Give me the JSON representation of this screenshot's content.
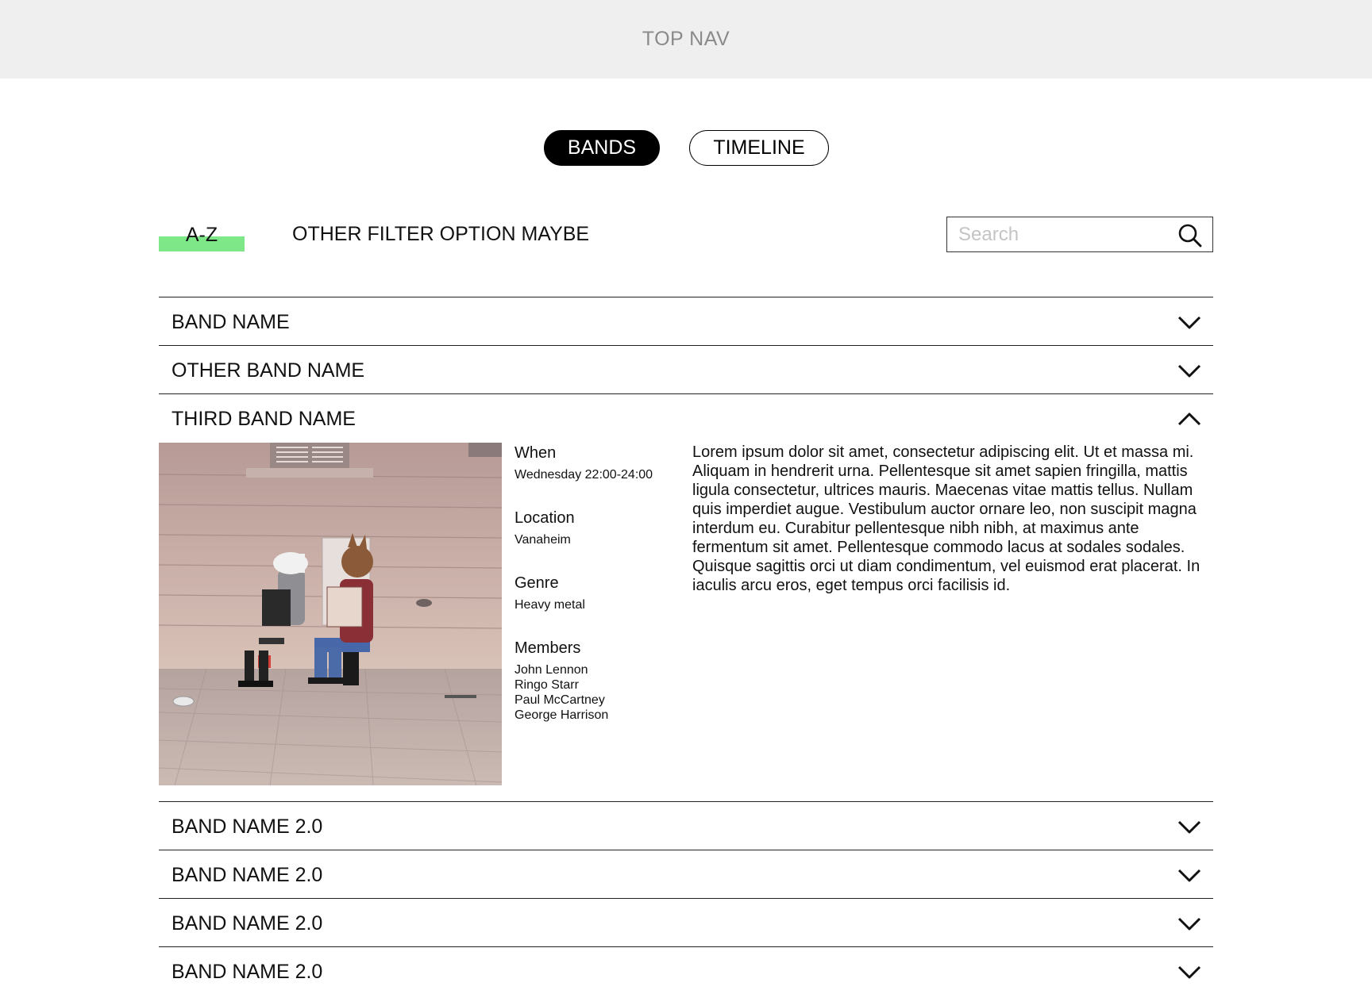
{
  "top_nav": {
    "label": "TOP NAV"
  },
  "view_toggle": {
    "bands": "BANDS",
    "timeline": "TIMELINE"
  },
  "filters": {
    "az": "A-Z",
    "other": "OTHER FILTER OPTION MAYBE"
  },
  "search": {
    "placeholder": "Search",
    "value": ""
  },
  "colors": {
    "filter_highlight": "#7ee787",
    "nav_bg": "#efefef"
  },
  "bands": [
    {
      "name": "BAND NAME",
      "expanded": false
    },
    {
      "name": "OTHER BAND NAME",
      "expanded": false
    },
    {
      "name": "THIRD BAND NAME",
      "expanded": true,
      "photo": "street-musicians-horse-masks-accordions",
      "when_label": "When",
      "when": "Wednesday 22:00-24:00",
      "location_label": "Location",
      "location": "Vanaheim",
      "genre_label": "Genre",
      "genre": "Heavy metal",
      "members_label": "Members",
      "members": [
        "John Lennon",
        "Ringo Starr",
        "Paul McCartney",
        "George Harrison"
      ],
      "description": "Lorem ipsum dolor sit amet, consectetur adipiscing elit. Ut et massa mi. Aliquam in hendrerit urna. Pellentesque sit amet sapien fringilla, mattis ligula consectetur, ultrices mauris. Maecenas vitae mattis tellus. Nullam quis imperdiet augue. Vestibulum auctor ornare leo, non suscipit magna interdum eu. Curabitur pellentesque nibh nibh, at maximus ante fermentum sit amet. Pellentesque commodo lacus at sodales sodales. Quisque sagittis orci ut diam condimentum, vel euismod erat placerat. In iaculis arcu eros, eget tempus orci facilisis id."
    },
    {
      "name": "BAND NAME 2.0",
      "expanded": false
    },
    {
      "name": "BAND NAME 2.0",
      "expanded": false
    },
    {
      "name": "BAND NAME 2.0",
      "expanded": false
    },
    {
      "name": "BAND NAME 2.0",
      "expanded": false
    }
  ]
}
